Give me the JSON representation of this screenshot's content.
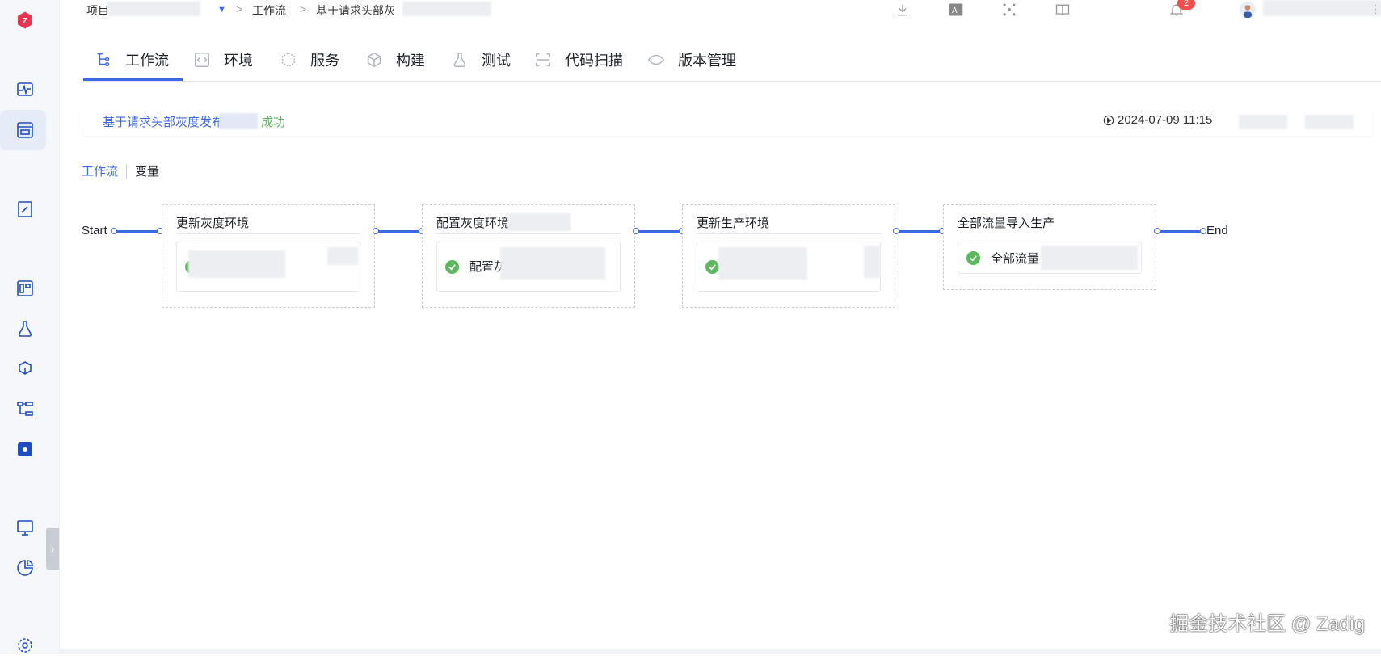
{
  "header": {
    "breadcrumb_project": "项目",
    "breadcrumb_sep1": ">",
    "breadcrumb_workflow": "工作流",
    "breadcrumb_sep2": ">",
    "breadcrumb_current": "基于请求头部灰",
    "notification_count": "2"
  },
  "tabs": [
    {
      "label": "工作流",
      "icon": "workflow-icon",
      "active": true
    },
    {
      "label": "环境",
      "icon": "code-icon"
    },
    {
      "label": "服务",
      "icon": "service-icon"
    },
    {
      "label": "构建",
      "icon": "build-icon"
    },
    {
      "label": "测试",
      "icon": "flask-icon"
    },
    {
      "label": "代码扫描",
      "icon": "scan-icon"
    },
    {
      "label": "版本管理",
      "icon": "version-icon"
    }
  ],
  "run": {
    "title": "基于请求头部灰度发布",
    "status": "成功",
    "start_time": "2024-07-09 11:15"
  },
  "subtabs": {
    "workflow": "工作流",
    "variables": "变量"
  },
  "pipeline": {
    "start_label": "Start",
    "end_label": "End",
    "stages": [
      {
        "title": "更新灰度环境",
        "job_label": ""
      },
      {
        "title": "配置灰度环境",
        "job_label": "配置灰"
      },
      {
        "title": "更新生产环境",
        "job_label": ""
      },
      {
        "title": "全部流量导入生产",
        "job_label": "全部流量"
      }
    ]
  },
  "footer": {
    "watermark": "掘金技术社区 @ Zadig"
  },
  "colors": {
    "accent": "#3c6ae6",
    "success": "#5bb85d",
    "badge": "#f24e4e"
  }
}
